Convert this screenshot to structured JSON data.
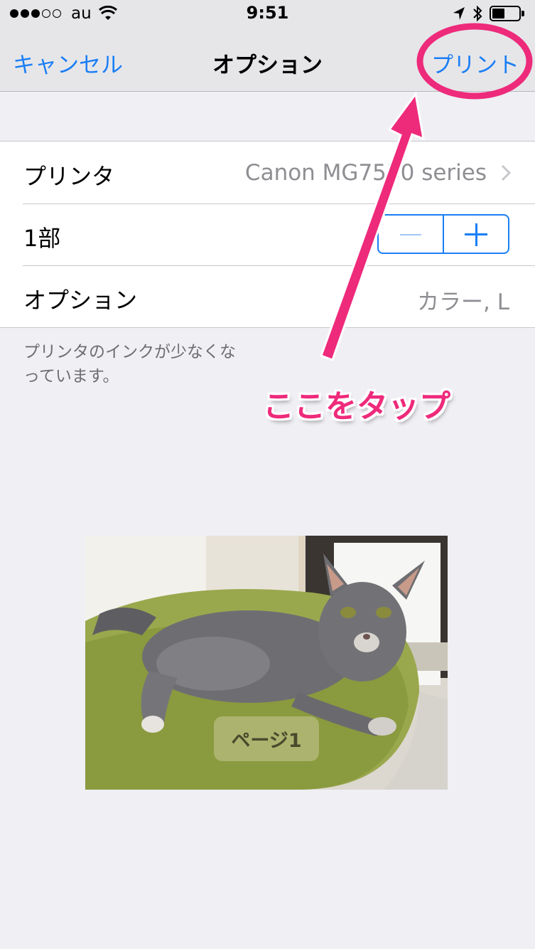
{
  "status_bar": {
    "carrier": "au",
    "time": "9:51",
    "signal_bars_filled": 3,
    "signal_bars_total": 5,
    "battery_level": 0.4
  },
  "nav": {
    "cancel_label": "キャンセル",
    "title": "オプション",
    "print_label": "プリント"
  },
  "settings": {
    "printer_label": "プリンタ",
    "printer_value": "Canon MG7530 series",
    "copies_label": "1部",
    "options_label": "オプション",
    "options_value": "カラー, L"
  },
  "footnote": "プリンタのインクが少なくなっています。",
  "annotation": {
    "text": "ここをタップ",
    "color": "#ee2a7b"
  },
  "preview": {
    "page_label": "ページ1"
  },
  "colors": {
    "accent": "#1a7ef5",
    "background": "#efeff4",
    "highlight": "#ee2a7b"
  },
  "icons": {
    "wifi": "wifi-icon",
    "location": "location-arrow-icon",
    "bluetooth": "bluetooth-icon",
    "battery": "battery-icon",
    "chevron": "chevron-right-icon"
  }
}
